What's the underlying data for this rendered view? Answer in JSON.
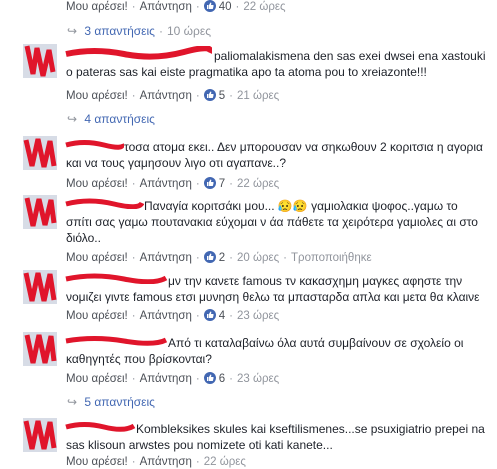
{
  "labels": {
    "like": "Μου αρέσει!",
    "reply": "Απάντηση",
    "edited": "Τροποποιήθηκε"
  },
  "colors": {
    "link": "#4267b2",
    "redaction": "#e0152b",
    "meta": "#90949c"
  },
  "rows": [
    {
      "likes": "40",
      "time": "22 ώρες"
    },
    {
      "replies_label": "3 απαντήσεις",
      "time": "10 ώρες"
    }
  ],
  "comments": [
    {
      "text": "paliomalakismena den sas exei dwsei ena xastouki o pateras sas kai eiste pragmatika apo ta atoma pou to xreiazonte!!!",
      "likes": "5",
      "time": "21 ώρες",
      "replies_label": "4 απαντήσεις"
    },
    {
      "text": "τοσα ατομα εκει.. Δεν μπορουσαν να σηκωθουν 2 κοριτσια η αγορια και να τους γαμησουν λιγο οτι αγαπανε..?",
      "likes": "7",
      "time": "22 ώρες"
    },
    {
      "text": "Παναγία κοριτσάκι μου... 😥😥 γαμιολακια ψοφος..γαμω το σπίτι σας γαμω πουτανακια εύχομαι ν άα πάθετε τα χειρότερα γαμιολες αι στο διόλο..",
      "likes": "2",
      "time": "20 ώρες"
    },
    {
      "text": "μν την κανετε famous τν κακασχημη μαγκες αφηστε την νομιζει γιντε famous ετσι μυνηση θελω τα μπασταρδα απλα και μετα θα κλαινε",
      "likes": "4",
      "time": "23 ώρες"
    },
    {
      "text": "Από τι καταλαβαίνω όλα αυτά συμβαίνουν σε σχολείο οι καθηγητές που βρίσκονται?",
      "likes": "6",
      "time": "23 ώρες",
      "replies_label": "5 απαντήσεις"
    },
    {
      "text": "Kombleksikes skules kai kseftilismenes...se psuxigiatrio prepei na sas klisoun arwstes pou nomizete oti kati kanete...",
      "time": "22 ώρες"
    }
  ]
}
